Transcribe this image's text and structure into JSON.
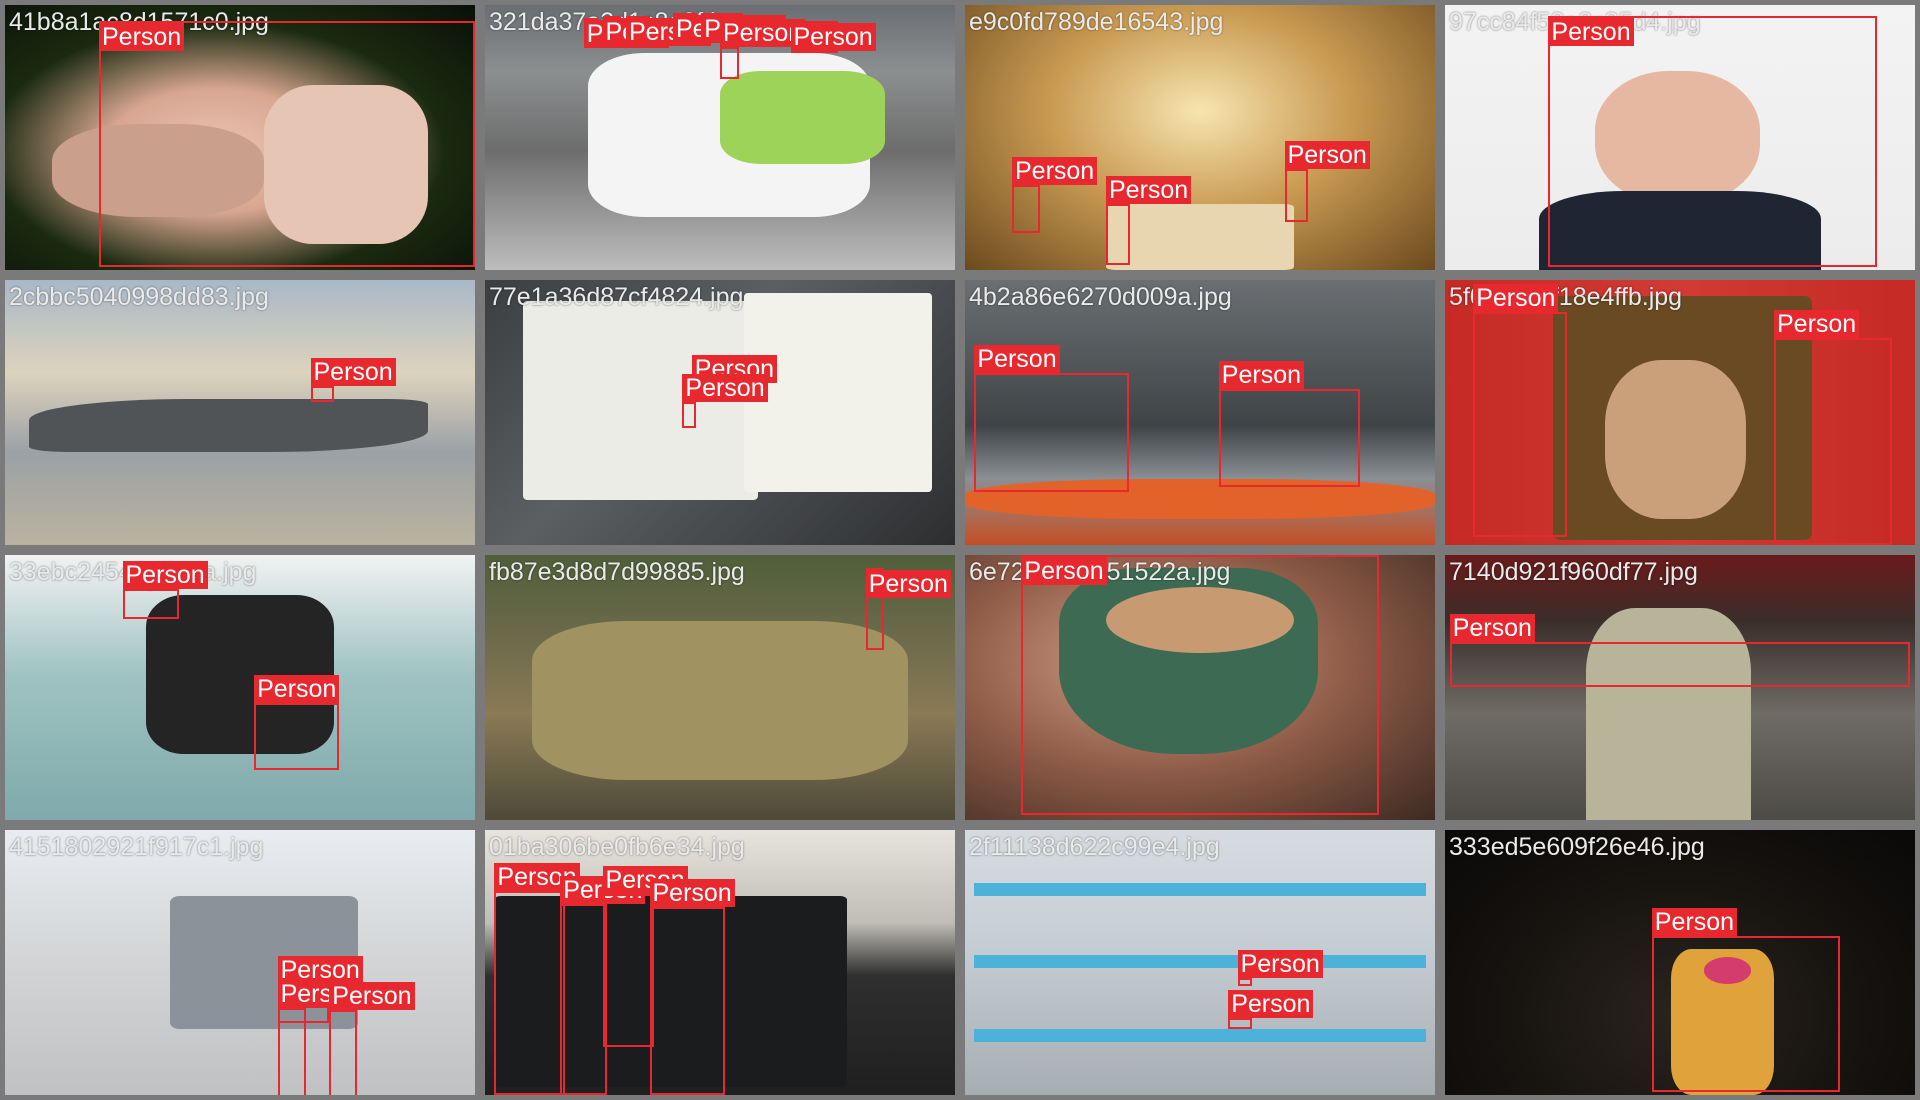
{
  "label_color": "#e8282f",
  "tiles": [
    {
      "filename": "41b8a1ac8d1571c0.jpg",
      "boxes": [
        {
          "label": "Person"
        }
      ]
    },
    {
      "filename": "321da37a2d1c8e2f.jpg",
      "boxes": [
        {
          "label": "Person"
        },
        {
          "label": "Person"
        },
        {
          "label": "Person"
        },
        {
          "label": "Person"
        },
        {
          "label": "Person"
        },
        {
          "label": "Person"
        },
        {
          "label": "Person"
        }
      ]
    },
    {
      "filename": "e9c0fd789de16543.jpg",
      "boxes": [
        {
          "label": "Person"
        },
        {
          "label": "Person"
        },
        {
          "label": "Person"
        }
      ]
    },
    {
      "filename": "97cc84f53a2c35d4.jpg",
      "boxes": [
        {
          "label": "Person"
        }
      ]
    },
    {
      "filename": "2cbbc5040998dd83.jpg",
      "boxes": [
        {
          "label": "Person"
        }
      ]
    },
    {
      "filename": "77e1a36d87cf4824.jpg",
      "boxes": [
        {
          "label": "Person"
        },
        {
          "label": "Person"
        }
      ]
    },
    {
      "filename": "4b2a86e6270d009a.jpg",
      "boxes": [
        {
          "label": "Person"
        },
        {
          "label": "Person"
        }
      ]
    },
    {
      "filename": "5f06a2c0f18e4ffb.jpg",
      "boxes": [
        {
          "label": "Person"
        },
        {
          "label": "Person"
        }
      ]
    },
    {
      "filename": "33ebc24545d071a.jpg",
      "boxes": [
        {
          "label": "Person"
        },
        {
          "label": "Person"
        }
      ]
    },
    {
      "filename": "fb87e3d8d7d99885.jpg",
      "boxes": [
        {
          "label": "Person"
        }
      ]
    },
    {
      "filename": "6e72dbc6e751522a.jpg",
      "boxes": [
        {
          "label": "Person"
        }
      ]
    },
    {
      "filename": "7140d921f960df77.jpg",
      "boxes": [
        {
          "label": "Person"
        }
      ]
    },
    {
      "filename": "4151802921f917c1.jpg",
      "boxes": [
        {
          "label": "Person"
        },
        {
          "label": "Person"
        },
        {
          "label": "Person"
        }
      ]
    },
    {
      "filename": "01ba306be0fb6e34.jpg",
      "boxes": [
        {
          "label": "Person"
        },
        {
          "label": "Person"
        },
        {
          "label": "Person"
        },
        {
          "label": "Person"
        }
      ]
    },
    {
      "filename": "2f11138d622c99e4.jpg",
      "boxes": [
        {
          "label": "Person"
        },
        {
          "label": "Person"
        }
      ]
    },
    {
      "filename": "333ed5e609f26e46.jpg",
      "boxes": [
        {
          "label": "Person"
        }
      ]
    }
  ]
}
